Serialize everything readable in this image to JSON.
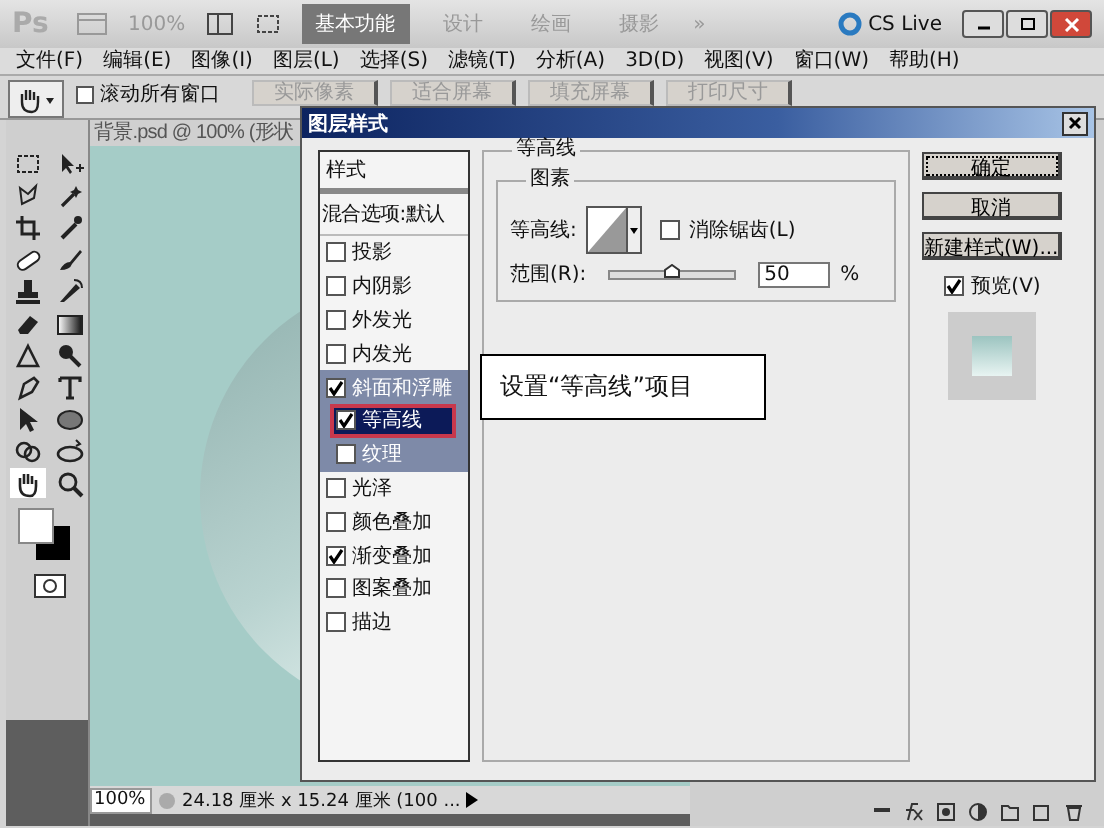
{
  "app_bar": {
    "logo": "Ps",
    "zoom": "100%",
    "workspaces": [
      {
        "label": "基本功能",
        "selected": true
      },
      {
        "label": "设计",
        "selected": false
      },
      {
        "label": "绘画",
        "selected": false
      },
      {
        "label": "摄影",
        "selected": false
      }
    ],
    "more": "»",
    "cs_live": "CS Live"
  },
  "menu": [
    "文件(F)",
    "编辑(E)",
    "图像(I)",
    "图层(L)",
    "选择(S)",
    "滤镜(T)",
    "分析(A)",
    "3D(D)",
    "视图(V)",
    "窗口(W)",
    "帮助(H)"
  ],
  "options_bar": {
    "scroll_all": {
      "label": "滚动所有窗口",
      "checked": false
    },
    "buttons": [
      {
        "label": "实际像素",
        "disabled": true
      },
      {
        "label": "适合屏幕",
        "disabled": true
      },
      {
        "label": "填充屏幕",
        "disabled": true
      },
      {
        "label": "打印尺寸",
        "disabled": true
      }
    ]
  },
  "tools": [
    {
      "kind": "marquee",
      "selected": false
    },
    {
      "kind": "move",
      "selected": false
    },
    {
      "kind": "lasso",
      "selected": false
    },
    {
      "kind": "wand",
      "selected": false
    },
    {
      "kind": "crop",
      "selected": false
    },
    {
      "kind": "eyedropper",
      "selected": false
    },
    {
      "kind": "heal",
      "selected": false
    },
    {
      "kind": "brush",
      "selected": false
    },
    {
      "kind": "stamp",
      "selected": false
    },
    {
      "kind": "history",
      "selected": false
    },
    {
      "kind": "eraser",
      "selected": false
    },
    {
      "kind": "gradient",
      "selected": false
    },
    {
      "kind": "blur",
      "selected": false
    },
    {
      "kind": "dodge",
      "selected": false
    },
    {
      "kind": "pen",
      "selected": false
    },
    {
      "kind": "type",
      "selected": false
    },
    {
      "kind": "select",
      "selected": false
    },
    {
      "kind": "shape",
      "selected": false
    },
    {
      "kind": "rotate3d",
      "selected": false
    },
    {
      "kind": "orbit3d",
      "selected": false
    },
    {
      "kind": "hand",
      "selected": true
    },
    {
      "kind": "zoom",
      "selected": false
    }
  ],
  "document": {
    "tab": "背景.psd @ 100% (形状",
    "zoom": "100%",
    "info": "24.18 厘米 x 15.24 厘米 (100 ..."
  },
  "dialog": {
    "title": "图层样式",
    "styles_header": "样式",
    "blend_options": "混合选项:默认",
    "effects": [
      {
        "label": "投影",
        "checked": false,
        "selected": false
      },
      {
        "label": "内阴影",
        "checked": false,
        "selected": false
      },
      {
        "label": "外发光",
        "checked": false,
        "selected": false
      },
      {
        "label": "内发光",
        "checked": false,
        "selected": false
      },
      {
        "label": "斜面和浮雕",
        "checked": true,
        "selected": false,
        "children": [
          {
            "label": "等高线",
            "checked": true,
            "selected": true
          },
          {
            "label": "纹理",
            "checked": false,
            "selected": false
          }
        ]
      },
      {
        "label": "光泽",
        "checked": false,
        "selected": false
      },
      {
        "label": "颜色叠加",
        "checked": false,
        "selected": false
      },
      {
        "label": "渐变叠加",
        "checked": true,
        "selected": false
      },
      {
        "label": "图案叠加",
        "checked": false,
        "selected": false
      },
      {
        "label": "描边",
        "checked": false,
        "selected": false
      }
    ],
    "section_title": "等高线",
    "group_title": "图素",
    "contour_label": "等高线:",
    "anti_alias": {
      "label": "消除锯齿(L)",
      "checked": false
    },
    "range_label": "范围(R):",
    "range": {
      "level": 0.5
    },
    "range_value": "50",
    "unit": "%",
    "buttons": [
      {
        "label": "确定",
        "default": true
      },
      {
        "label": "取消",
        "default": false
      },
      {
        "label": "新建样式(W)...",
        "default": false
      }
    ],
    "preview": {
      "label": "预览(V)",
      "checked": true
    }
  },
  "callout": "设置“等高线”项目"
}
